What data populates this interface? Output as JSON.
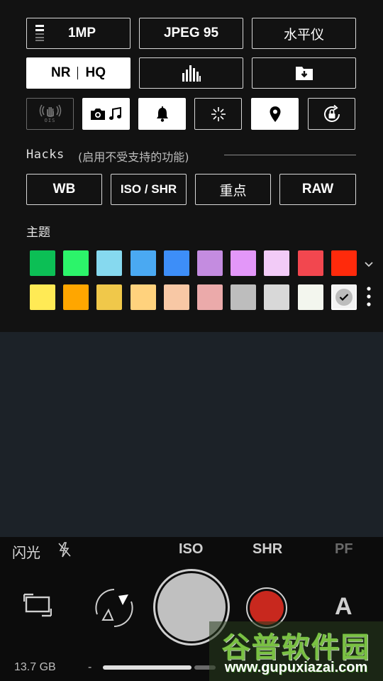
{
  "row1": {
    "resolution": "1MP",
    "jpeg": "JPEG 95",
    "level": "水平仪"
  },
  "row2": {
    "nr": "NR",
    "hq": "HQ"
  },
  "row3": {
    "ois_label": "OIS"
  },
  "hacks": {
    "title": "Hacks",
    "subtitle": "(启用不受支持的功能)",
    "buttons": [
      "WB",
      "ISO / SHR",
      "重点",
      "RAW"
    ]
  },
  "theme": {
    "title": "主题",
    "colors_row1": [
      "#0cbf55",
      "#2cf46a",
      "#86d9ef",
      "#4aa9f2",
      "#3d8ef8",
      "#c48ce0",
      "#e397f9",
      "#f2cbf7",
      "#f2474f",
      "#ff2a0b"
    ],
    "colors_row2": [
      "#ffea55",
      "#ffa600",
      "#f0c84a",
      "#ffd27d",
      "#f8c8a5",
      "#ebaaaa",
      "#bdbdbd",
      "#d8d8d8",
      "#f3f6ee",
      "#ffffff"
    ]
  },
  "camera_bar": {
    "flash": "闪光",
    "iso": "ISO",
    "shr": "SHR",
    "pf": "PF",
    "mode": "A"
  },
  "status": {
    "storage": "13.7 GB",
    "dash": "-"
  },
  "watermark": {
    "title": "谷普软件园",
    "url": "www.gupuxiazai.com"
  }
}
